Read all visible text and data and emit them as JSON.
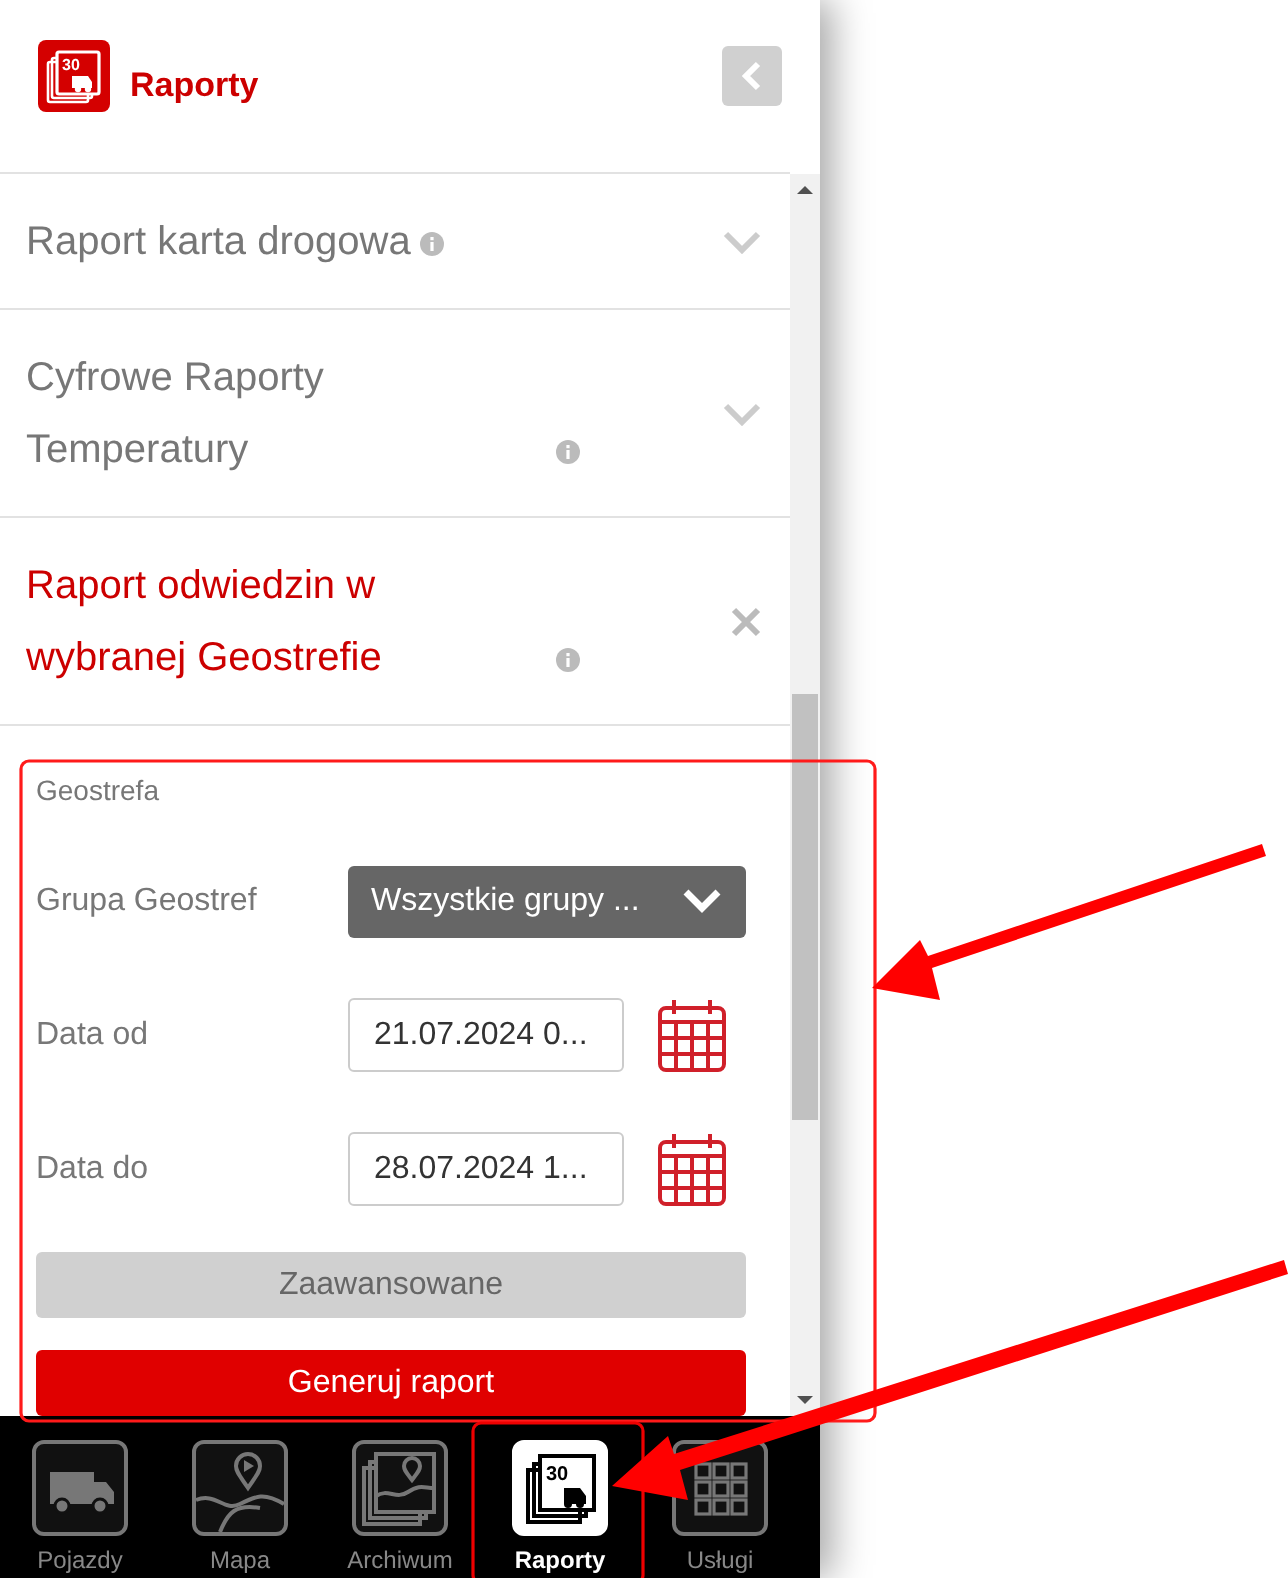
{
  "header": {
    "title": "Raporty",
    "icon_label": "30"
  },
  "reports": [
    {
      "title": "Raport karta drogowa",
      "info": true,
      "expanded": false
    },
    {
      "title": "Cyfrowe Raporty Temperatury",
      "info": true,
      "expanded": false
    },
    {
      "title": "Raport odwiedzin w wybranej Geostrefie",
      "info": true,
      "expanded": true
    }
  ],
  "form": {
    "section": "Geostrefa",
    "fields": [
      {
        "kind": "select",
        "label": "Grupa Geostref",
        "value": "Wszystkie grupy ..."
      },
      {
        "kind": "date",
        "label": "Data od",
        "value": "21.07.2024 0..."
      },
      {
        "kind": "date",
        "label": "Data do",
        "value": "28.07.2024 1..."
      }
    ],
    "advanced_button": "Zaawansowane",
    "submit_button": "Generuj raport"
  },
  "nav": [
    {
      "kind": "truck",
      "label": "Pojazdy",
      "selected": false
    },
    {
      "kind": "map",
      "label": "Mapa",
      "selected": false
    },
    {
      "kind": "archive",
      "label": "Archiwum",
      "selected": false
    },
    {
      "kind": "report",
      "label": "Raporty",
      "selected": true,
      "icon_label": "30"
    },
    {
      "kind": "grid",
      "label": "Usługi",
      "selected": false
    }
  ],
  "annotations": [
    {
      "kind": "form-frame"
    },
    {
      "kind": "tab-frame"
    },
    {
      "kind": "form-arrow"
    },
    {
      "kind": "tab-arrow"
    }
  ]
}
